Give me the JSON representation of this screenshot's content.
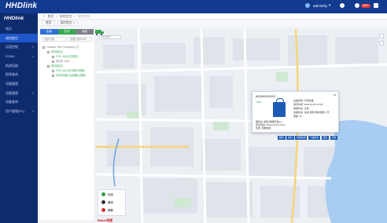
{
  "header": {
    "logo": "HHDlink",
    "user": "admin/ky",
    "notify_badge": "999+",
    "bg": "#123a8e"
  },
  "sidebar": {
    "brand": "HHDlink",
    "items": [
      {
        "label": "首页",
        "active": false,
        "arrow": false
      },
      {
        "label": "实时定位",
        "active": true,
        "arrow": false
      },
      {
        "label": "远程控制",
        "active": false,
        "arrow": true
      },
      {
        "label": "ECMU",
        "active": false,
        "arrow": true
      },
      {
        "label": "轨迹回放",
        "active": false,
        "arrow": false
      },
      {
        "label": "报表查询",
        "active": false,
        "arrow": false
      },
      {
        "label": "设备管理",
        "active": false,
        "arrow": false
      },
      {
        "label": "设备管理",
        "active": false,
        "arrow": true
      },
      {
        "label": "设备查询",
        "active": false,
        "arrow": false
      },
      {
        "label": "用户管理(PC)",
        "active": false,
        "arrow": true
      }
    ]
  },
  "breadcrumb": [
    "首页",
    "实时定位",
    "实时定位"
  ],
  "tabs": [
    "首页",
    "实时定位"
  ],
  "panel": {
    "segments": [
      {
        "label": "全部",
        "color": "#2f6fd6"
      },
      {
        "label": "在线",
        "color": "#35a853"
      },
      {
        "label": "离线",
        "color": "#7b7f88"
      }
    ],
    "filter_a": "全部分组",
    "filter_b": "设备名称/IMEI",
    "tree": [
      {
        "text": "Huawei Test Company (7)",
        "level": 1,
        "color": "gray"
      },
      {
        "text": "测试组(2)",
        "level": 2,
        "color": "green"
      },
      {
        "text": "DSC-Z(0)(已绑定)",
        "level": 3,
        "color": "green"
      },
      {
        "text": "测试Z-1(0)",
        "level": 3,
        "color": "gray"
      },
      {
        "text": "测试组(5)",
        "level": 2,
        "color": "green"
      },
      {
        "text": "DSC-A(1)(已绑定/设备)",
        "level": 3,
        "color": "green"
      },
      {
        "text": "测试设备(5)(设备)(设备)",
        "level": 3,
        "color": "green"
      }
    ]
  },
  "map": {
    "search_placeholder": "地址搜索",
    "legend": [
      {
        "label": "在线",
        "color": "#2e9e44"
      },
      {
        "label": "离线",
        "color": "#333333"
      },
      {
        "label": "报警",
        "color": "#d32f2f"
      }
    ],
    "attribution": "Baidu地图"
  },
  "popup": {
    "imei": "862885040200",
    "status": "32%",
    "left_lines": [
      "锁状态: 施封(锁绳已插入)",
      "定位时间: 2022-03-15 13:19",
      "位置: 查看地址"
    ],
    "right_lines": [
      "设备名称: 示例设备",
      "通讯时间: 2022-03-15 13:20",
      "电量状态: 正常",
      "设备状态: 在线 施封 剩余电量 4 天",
      "电量: 32"
    ],
    "actions": [
      "解封",
      "施封",
      "查看轨迹",
      "下发指令",
      "更多",
      "详情"
    ]
  }
}
